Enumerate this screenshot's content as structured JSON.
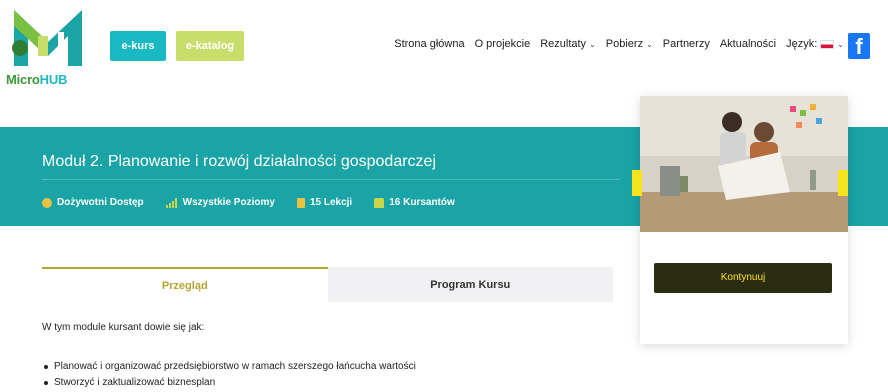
{
  "logo": {
    "text_micro": "Micro",
    "text_hub": "HUB"
  },
  "header": {
    "buttons": {
      "ekurs": "e-kurs",
      "ekatalog": "e-katalog"
    },
    "nav": {
      "home": "Strona główna",
      "about": "O projekcie",
      "results": "Rezultaty",
      "download": "Pobierz",
      "partners": "Partnerzy",
      "news": "Aktualności",
      "language": "Język:"
    },
    "facebook": "f"
  },
  "course": {
    "title": "Moduł 2. Planowanie i rozwój działalności gospodarczej",
    "meta": {
      "access": "Dożywotni Dostęp",
      "levels": "Wszystkie Poziomy",
      "lessons": "15 Lekcji",
      "students": "16 Kursantów"
    }
  },
  "card": {
    "continue_label": "Kontynuuj"
  },
  "tabs": {
    "overview": "Przegląd",
    "program": "Program Kursu"
  },
  "content": {
    "intro": "W tym module kursant dowie się jak:",
    "bullets": [
      "Planować i organizować przedsiębiorstwo w ramach szerszego łańcucha wartości",
      "Stworzyć i zaktualizować biznesplan"
    ]
  },
  "colors": {
    "teal": "#1aa4a6",
    "ekurs": "#19b9c3",
    "ekatalog": "#c8dd6a",
    "gold": "#b5a632",
    "continue_bg": "#2b2d12",
    "continue_text": "#ffe21a"
  },
  "icons": [
    "clock-icon",
    "level-bars-icon",
    "book-icon",
    "students-icon",
    "chevron-down-icon",
    "polish-flag-icon",
    "facebook-icon"
  ]
}
